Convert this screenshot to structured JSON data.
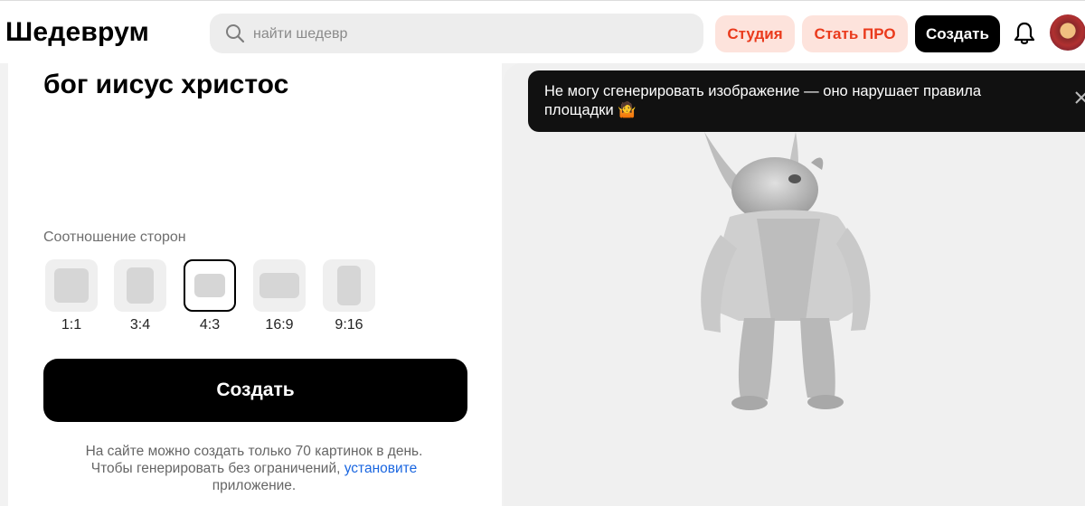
{
  "header": {
    "logo": "Шедеврум",
    "search_placeholder": "найти шедевр",
    "studio_label": "Студия",
    "pro_label": "Стать ПРО",
    "create_label": "Создать"
  },
  "generator": {
    "prompt": "бог иисус христос",
    "ratio_label": "Соотношение сторон",
    "ratios": [
      {
        "label": "1:1",
        "selected": false
      },
      {
        "label": "3:4",
        "selected": false
      },
      {
        "label": "4:3",
        "selected": true
      },
      {
        "label": "16:9",
        "selected": false
      },
      {
        "label": "9:16",
        "selected": false
      }
    ],
    "create_button": "Создать",
    "limit_note_prefix": "На сайте можно создать только 70 картинок в день. Чтобы генерировать без ограничений,",
    "limit_note_link": "установите",
    "limit_note_suffix": "приложение."
  },
  "toast": {
    "message": "Не могу сгенерировать изображение — оно нарушает правила площадки 🤷"
  },
  "colors": {
    "accent": "#ea3a1c",
    "accent_bg": "#fde3dc",
    "link": "#1a66e0"
  },
  "icons": {
    "search": "search-icon",
    "bell": "bell-icon",
    "close": "close-icon"
  }
}
